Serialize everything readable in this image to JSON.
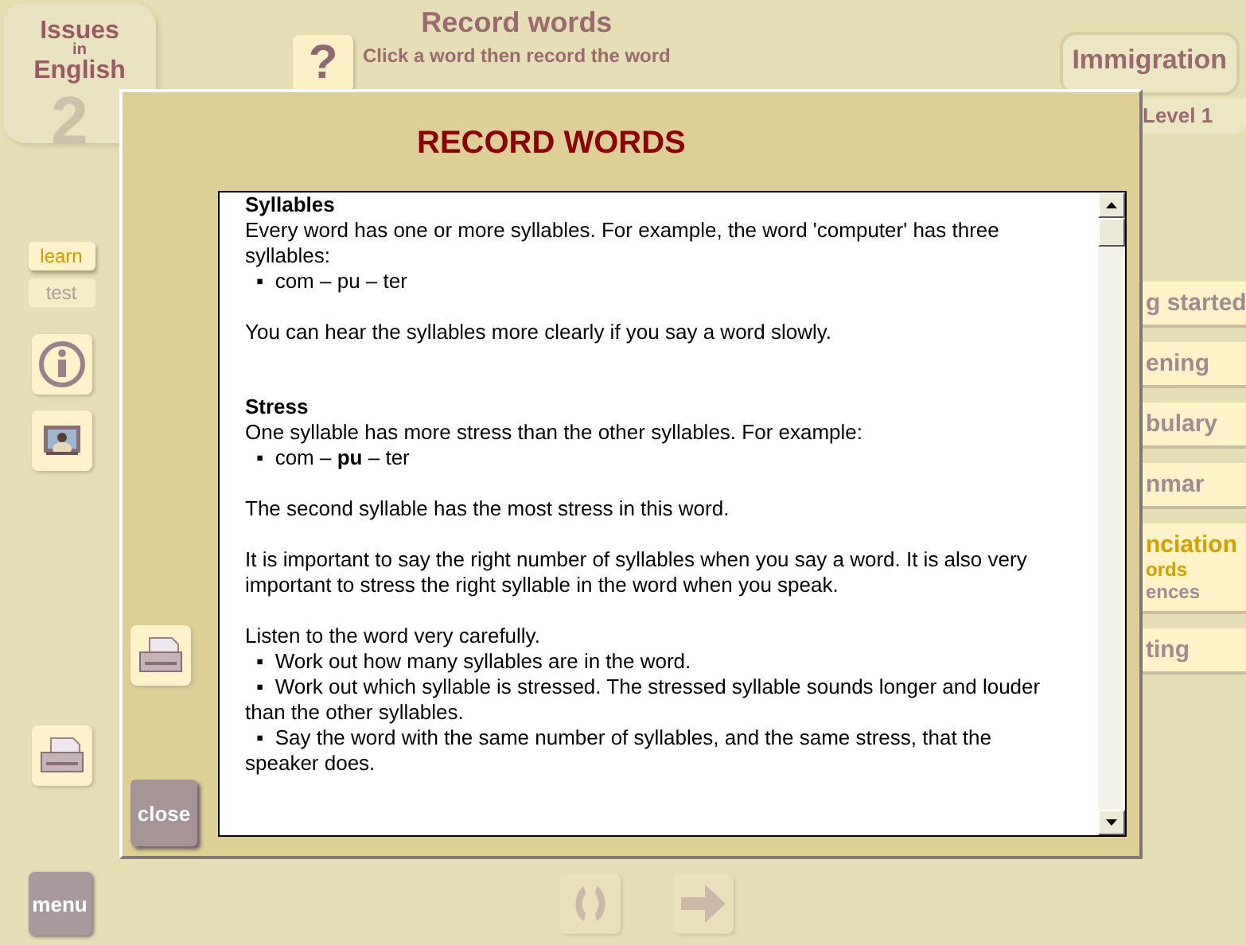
{
  "app": {
    "logo": {
      "numeral": "2",
      "lines": [
        "Issues",
        "in",
        "English"
      ]
    },
    "help_button": "?",
    "title": "Record words",
    "instruction": "Click a word then record the word",
    "topic_tab": "Immigration",
    "level": "Level 1"
  },
  "modes": [
    {
      "label": "learn",
      "selected": true
    },
    {
      "label": "test",
      "selected": false
    }
  ],
  "side_nav": [
    {
      "label": "g started",
      "selected": false
    },
    {
      "label": "ening",
      "selected": false
    },
    {
      "label": "bulary",
      "selected": false
    },
    {
      "label": "nmar",
      "selected": false
    },
    {
      "label": "nciation",
      "selected": true,
      "children": [
        {
          "label": "ords",
          "selected": true
        },
        {
          "label": "ences",
          "selected": false
        }
      ]
    },
    {
      "label": "ting",
      "selected": false
    }
  ],
  "bottom_nav": [
    {
      "kind": "refresh",
      "disabled": true
    },
    {
      "kind": "next",
      "disabled": true
    }
  ],
  "menu_button": "menu",
  "dialog": {
    "title": "RECORD WORDS",
    "close_button": "close",
    "sections": [
      {
        "heading": "Syllables",
        "blocks": [
          {
            "kind": "paragraph",
            "text": "Every word has one or more syllables.  For example, the word 'computer' has three syllables:"
          },
          {
            "kind": "list",
            "items": [
              "▪  com – pu – ter"
            ]
          },
          {
            "kind": "paragraph",
            "text": "You can hear the syllables more clearly if you say a word slowly."
          }
        ]
      },
      {
        "heading": "Stress",
        "blocks": [
          {
            "kind": "paragraph",
            "text": "One syllable has more stress than the other syllables.  For example:"
          },
          {
            "kind": "list",
            "items": [
              "▪  com – **pu** – ter"
            ]
          },
          {
            "kind": "paragraph",
            "text": "The second syllable has the most stress in this word."
          },
          {
            "kind": "paragraph",
            "text": "It is important to say the right number of syllables when you say a word. It is also very important to stress the right syllable in the word when you speak."
          },
          {
            "kind": "paragraph",
            "text": "Listen to the word very carefully."
          },
          {
            "kind": "list",
            "items": [
              "▪  Work out how many syllables are in the word.",
              "▪  Work out which syllable is stressed. The stressed syllable sounds longer and louder than the other syllables.",
              "▪  Say the word with the same number of syllables, and the same stress, that the speaker does."
            ]
          }
        ]
      }
    ]
  }
}
